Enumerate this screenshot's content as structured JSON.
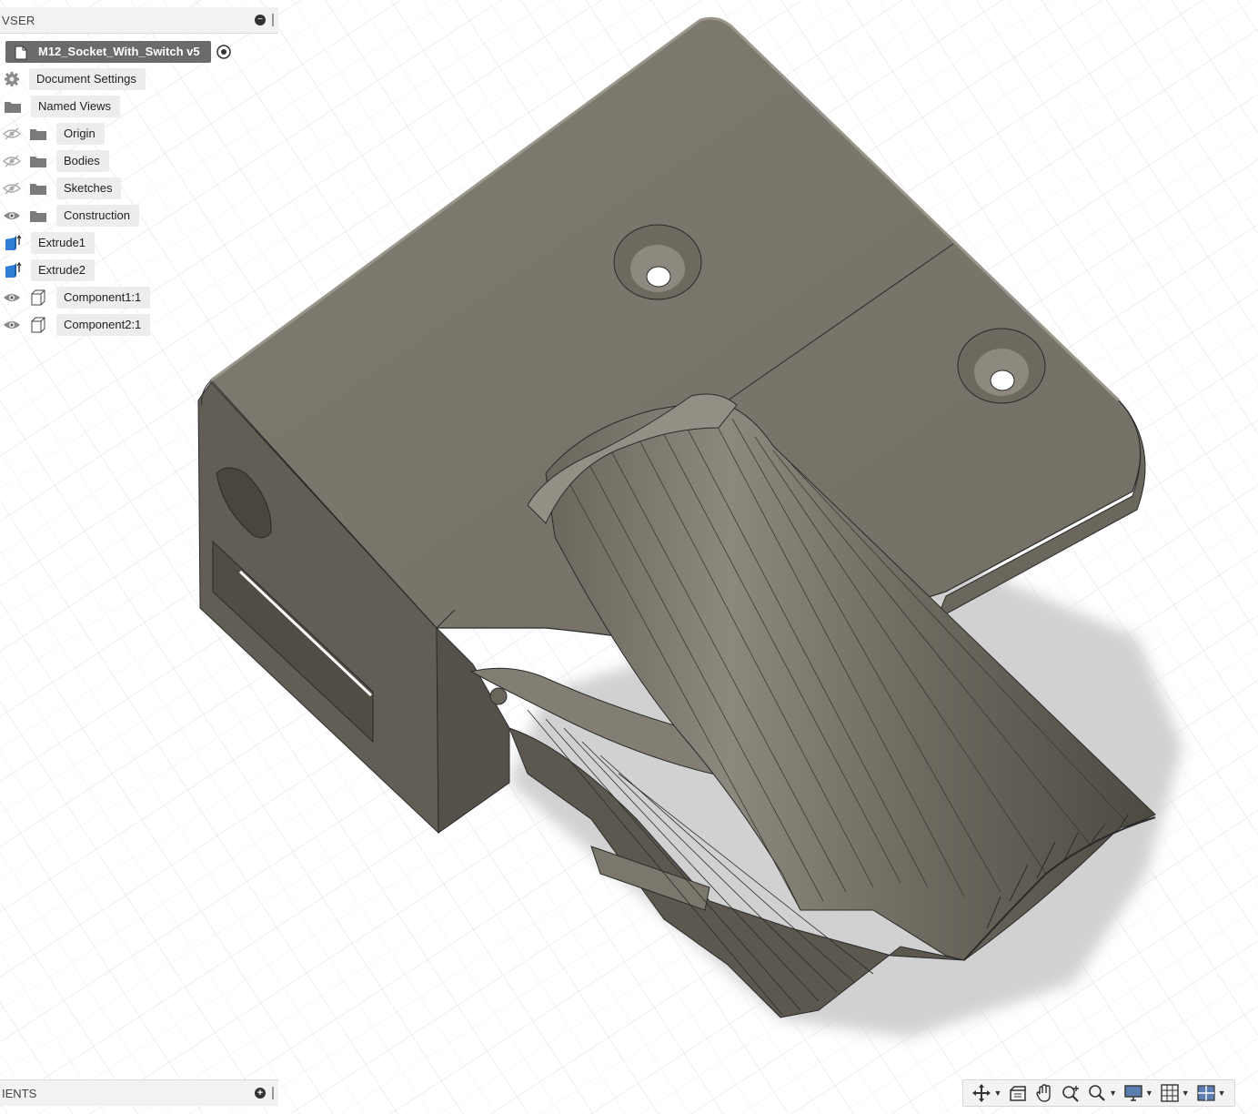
{
  "browser": {
    "header_title": "VSER",
    "collapse_symbol": "−",
    "document": {
      "name": "M12_Socket_With_Switch v5"
    },
    "items": [
      {
        "label": "Document Settings",
        "icon": "gear-icon",
        "visibility": "none"
      },
      {
        "label": "Named Views",
        "icon": "folder-icon",
        "visibility": "none"
      },
      {
        "label": "Origin",
        "icon": "folder-icon",
        "visibility": "hidden"
      },
      {
        "label": "Bodies",
        "icon": "folder-icon",
        "visibility": "hidden"
      },
      {
        "label": "Sketches",
        "icon": "folder-icon",
        "visibility": "hidden"
      },
      {
        "label": "Construction",
        "icon": "folder-icon",
        "visibility": "visible"
      },
      {
        "label": "Extrude1",
        "icon": "extrude-icon",
        "visibility": "none"
      },
      {
        "label": "Extrude2",
        "icon": "extrude-icon",
        "visibility": "none"
      },
      {
        "label": "Component1:1",
        "icon": "component-icon",
        "visibility": "visible"
      },
      {
        "label": "Component2:1",
        "icon": "component-icon",
        "visibility": "visible"
      }
    ]
  },
  "comments": {
    "title": "IENTS",
    "add_symbol": "+"
  },
  "nav_toolbar": [
    "orbit-icon",
    "look-at-icon",
    "pan-icon",
    "zoom-icon",
    "fit-icon",
    "display-settings-icon",
    "grid-settings-icon",
    "viewports-icon"
  ],
  "colors": {
    "model_top": "#7a766c",
    "model_side": "#5f5b52",
    "grid": "#d9d9d9",
    "doc_label_bg": "#6b6b6b",
    "extrude_blue": "#2f7fd6"
  }
}
